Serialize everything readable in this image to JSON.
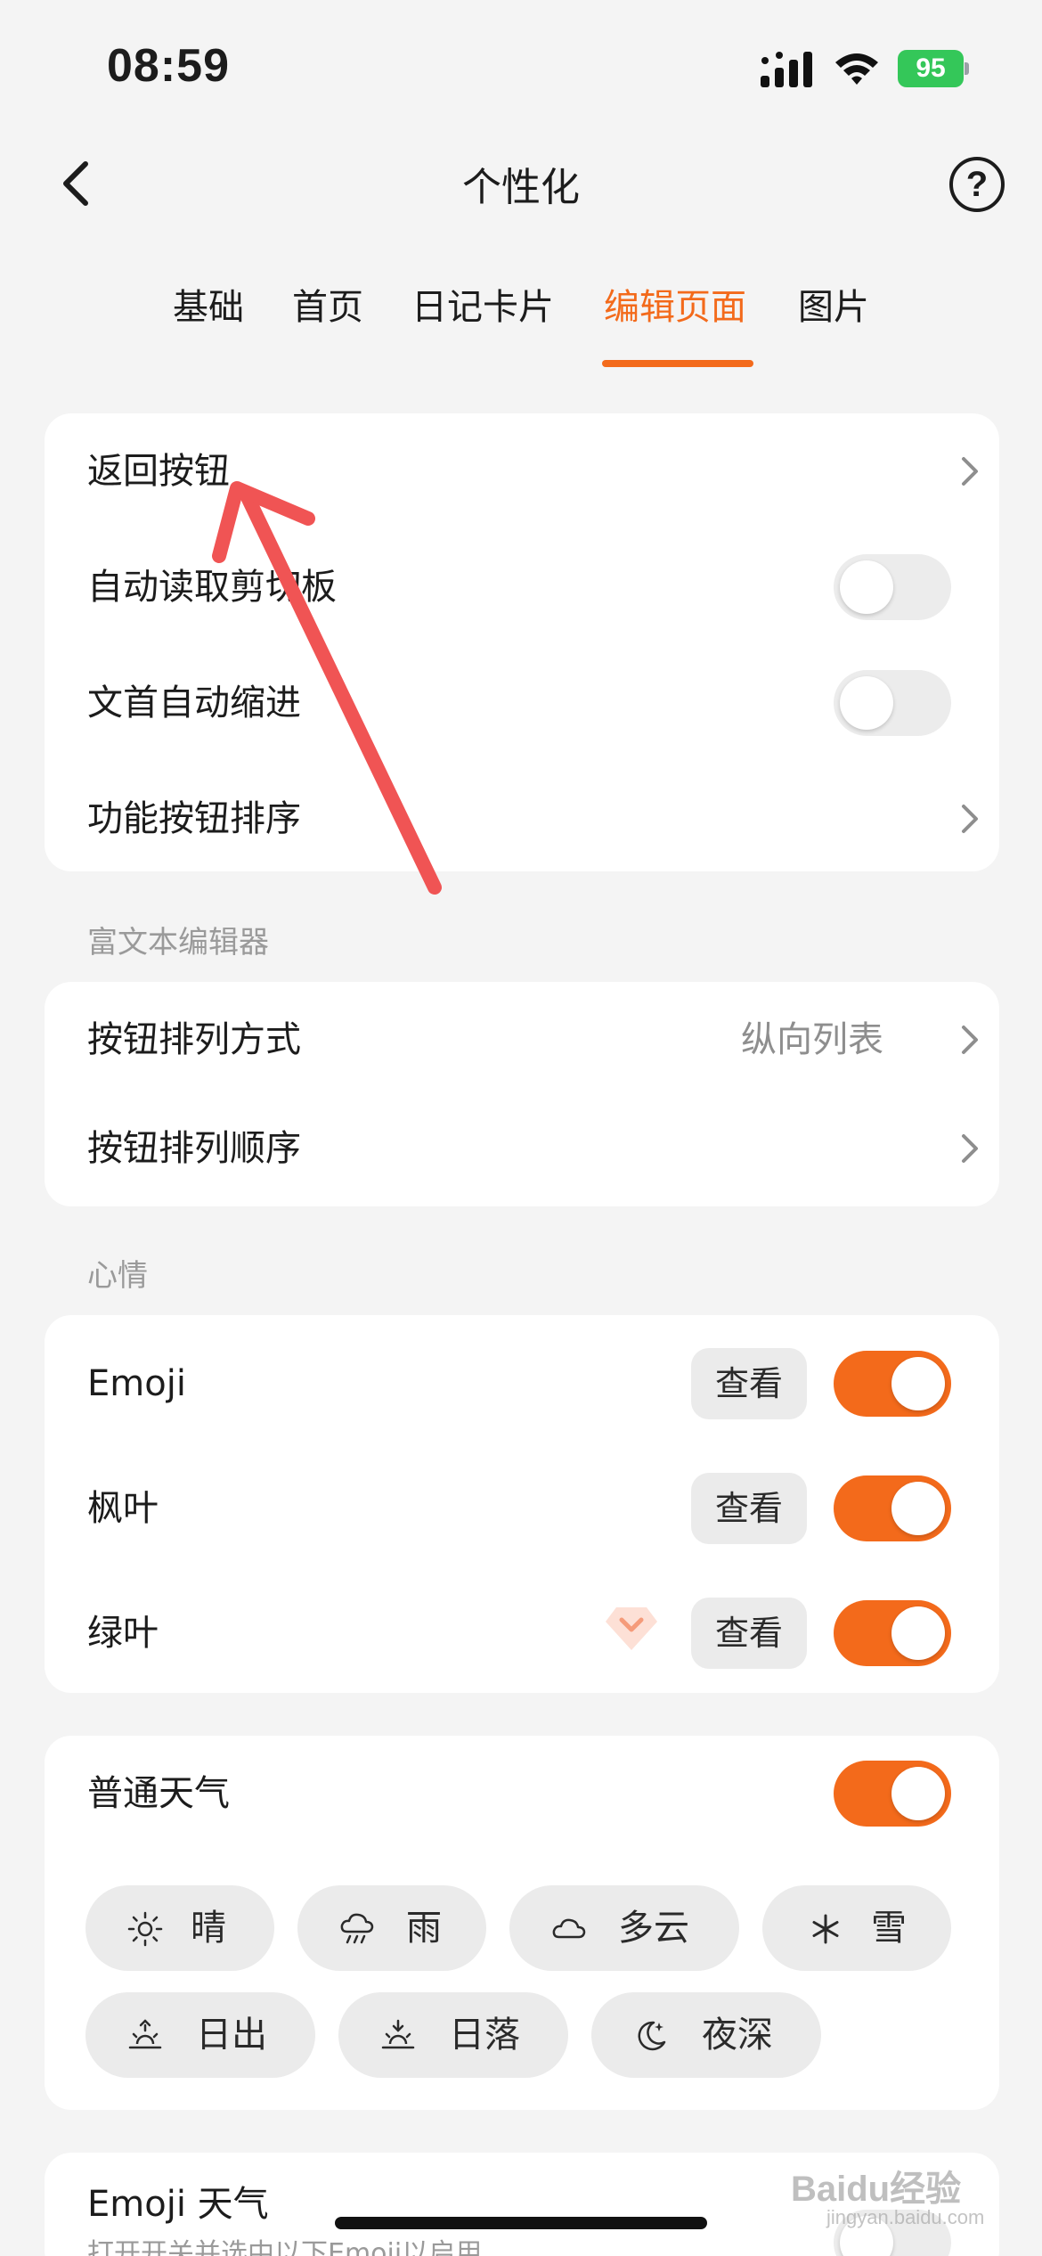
{
  "status_bar": {
    "time": "08:59",
    "battery": "95"
  },
  "nav": {
    "title": "个性化",
    "help": "?"
  },
  "tabs": [
    {
      "label": "基础",
      "active": false
    },
    {
      "label": "首页",
      "active": false
    },
    {
      "label": "日记卡片",
      "active": false
    },
    {
      "label": "编辑页面",
      "active": true
    },
    {
      "label": "图片",
      "active": false
    }
  ],
  "general_group": {
    "items": [
      {
        "label": "返回按钮",
        "type": "link"
      },
      {
        "label": "自动读取剪切板",
        "type": "toggle",
        "on": false
      },
      {
        "label": "文首自动缩进",
        "type": "toggle",
        "on": false
      },
      {
        "label": "功能按钮排序",
        "type": "link"
      }
    ]
  },
  "rich_text_section": {
    "header": "富文本编辑器",
    "items": [
      {
        "label": "按钮排列方式",
        "value": "纵向列表"
      },
      {
        "label": "按钮排列顺序"
      }
    ]
  },
  "mood_section": {
    "header": "心情",
    "view_label": "查看",
    "items": [
      {
        "label": "Emoji",
        "on": true
      },
      {
        "label": "枫叶",
        "on": true
      },
      {
        "label": "绿叶",
        "on": true,
        "premium": true
      }
    ]
  },
  "weather_section": {
    "label": "普通天气",
    "on": true,
    "chips": [
      {
        "label": "晴",
        "icon": "sun-icon"
      },
      {
        "label": "雨",
        "icon": "rain-icon"
      },
      {
        "label": "多云",
        "icon": "cloud-icon"
      },
      {
        "label": "雪",
        "icon": "snowflake-icon"
      },
      {
        "label": "日出",
        "icon": "sunrise-icon"
      },
      {
        "label": "日落",
        "icon": "sunset-icon"
      },
      {
        "label": "夜深",
        "icon": "moon-icon"
      }
    ]
  },
  "emoji_weather": {
    "label": "Emoji 天气",
    "subtext": "打开开关并选中以下Emoji以启用"
  },
  "watermark": {
    "brand": "Baidu经验",
    "site": "jingyan.baidu.com"
  },
  "colors": {
    "accent": "#f36a1b",
    "background": "#f4f4f4",
    "card": "#ffffff",
    "annotation": "#f05454"
  }
}
